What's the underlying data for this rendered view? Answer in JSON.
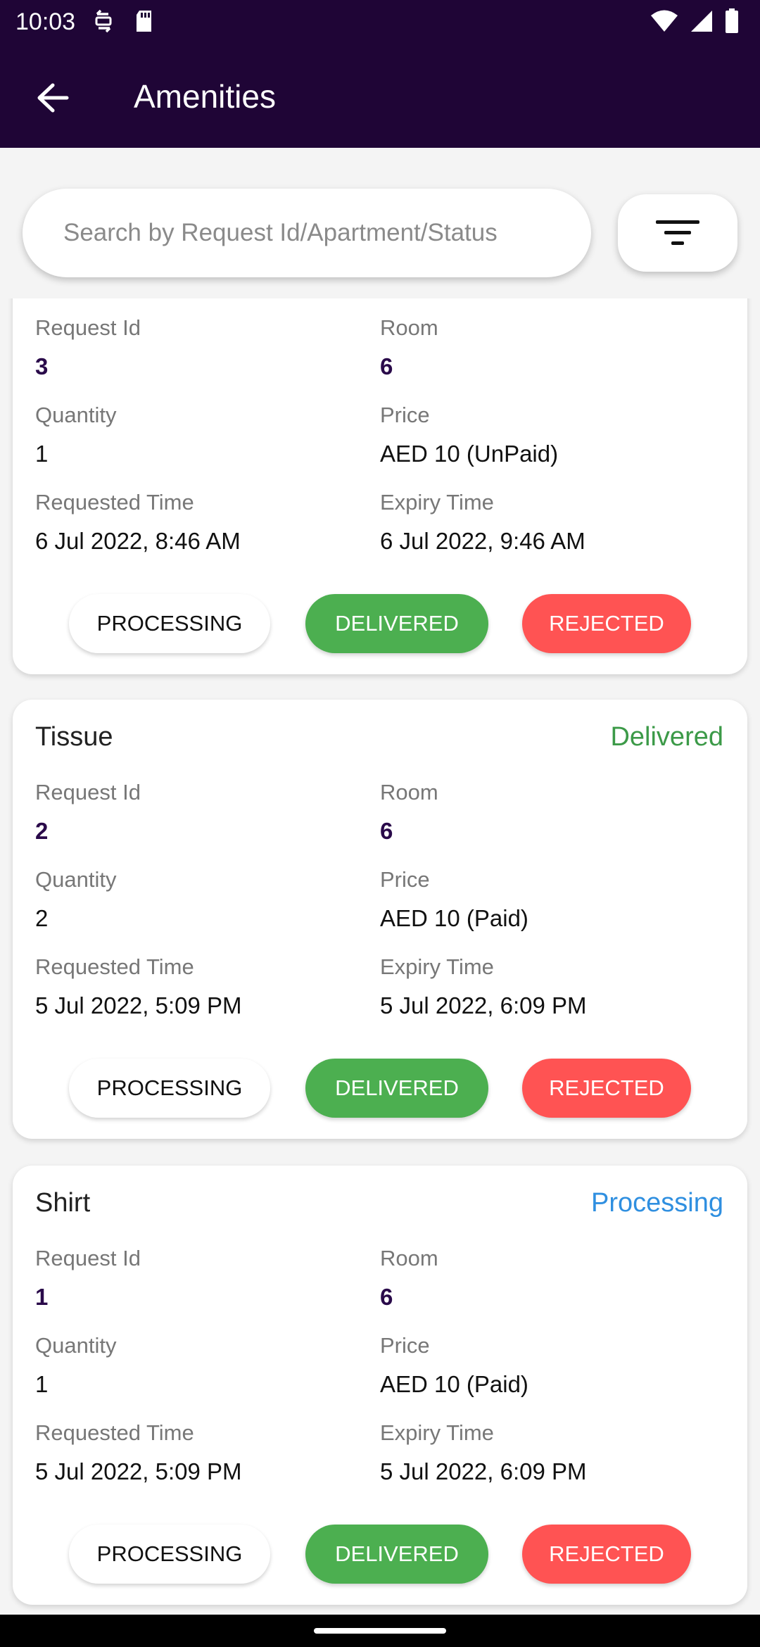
{
  "status_bar": {
    "time": "10:03"
  },
  "app_bar": {
    "title": "Amenities"
  },
  "search": {
    "placeholder": "Search by Request Id/Apartment/Status"
  },
  "labels": {
    "request_id": "Request Id",
    "room": "Room",
    "quantity": "Quantity",
    "price": "Price",
    "requested_time": "Requested Time",
    "expiry_time": "Expiry Time"
  },
  "buttons": {
    "processing": "PROCESSING",
    "delivered": "DELIVERED",
    "rejected": "REJECTED"
  },
  "cards": [
    {
      "name": "",
      "status": "",
      "request_id": "3",
      "room": "6",
      "quantity": "1",
      "price": "AED 10 (UnPaid)",
      "requested_time": "6 Jul 2022, 8:46 AM",
      "expiry_time": "6 Jul 2022, 9:46 AM"
    },
    {
      "name": "Tissue",
      "status": "Delivered",
      "status_color": "#3c9a48",
      "request_id": "2",
      "room": "6",
      "quantity": "2",
      "price": "AED 10 (Paid)",
      "requested_time": "5 Jul 2022, 5:09 PM",
      "expiry_time": "5 Jul 2022, 6:09 PM"
    },
    {
      "name": "Shirt",
      "status": "Processing",
      "status_color": "#2f8fe0",
      "request_id": "1",
      "room": "6",
      "quantity": "1",
      "price": "AED 10 (Paid)",
      "requested_time": "5 Jul 2022, 5:09 PM",
      "expiry_time": "5 Jul 2022, 6:09 PM"
    }
  ],
  "colors": {
    "header_bg": "#1f0536",
    "delivered": "#4caf50",
    "rejected": "#ff5353",
    "accent_value": "#2a0a4a"
  }
}
